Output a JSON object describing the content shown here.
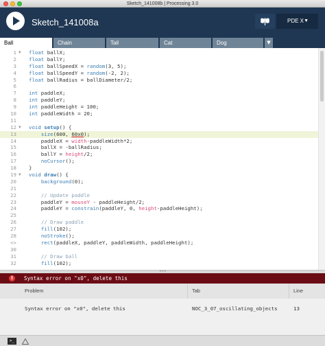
{
  "window": {
    "title": "Sketch_141008b  |  Processing 3.0"
  },
  "toolbar": {
    "sketch_name": "Sketch_141008a",
    "mode_label": "PDE X",
    "mode_caret": "▼"
  },
  "tabs": [
    {
      "label": "Ball",
      "active": true
    },
    {
      "label": "Chain",
      "active": false
    },
    {
      "label": "Tail",
      "active": false
    },
    {
      "label": "Cat",
      "active": false
    },
    {
      "label": "Dog",
      "active": false
    }
  ],
  "tab_menu_glyph": "▼",
  "editor": {
    "current_line": 13,
    "error_line": 12,
    "lines": [
      {
        "n": "1",
        "fold": "▼",
        "text": "float ballX;"
      },
      {
        "n": "2",
        "fold": "",
        "text": "float ballY;"
      },
      {
        "n": "3",
        "fold": "",
        "text": "float ballSpeedX = random(3, 5);"
      },
      {
        "n": "4",
        "fold": "",
        "text": "float ballSpeedY = random(-2, 2);"
      },
      {
        "n": "5",
        "fold": "",
        "text": "float ballRadius = ballDiameter/2;"
      },
      {
        "n": "6",
        "fold": "",
        "text": ""
      },
      {
        "n": "7",
        "fold": "",
        "text": "int paddleX;"
      },
      {
        "n": "8",
        "fold": "",
        "text": "int paddleY;"
      },
      {
        "n": "9",
        "fold": "",
        "text": "int paddleHeight = 100;"
      },
      {
        "n": "10",
        "fold": "",
        "text": "int paddleWidth = 20;"
      },
      {
        "n": "11",
        "fold": "",
        "text": ""
      },
      {
        "n": "12",
        "fold": "▼",
        "text": "void setup() {"
      },
      {
        "n": "13",
        "fold": "",
        "text": "    size(600, 60x0);"
      },
      {
        "n": "14",
        "fold": "",
        "text": "    paddleX = width-paddleWidth*2;"
      },
      {
        "n": "15",
        "fold": "",
        "text": "    ballX = -ballRadius;"
      },
      {
        "n": "16",
        "fold": "",
        "text": "    ballY = height/2;"
      },
      {
        "n": "17",
        "fold": "",
        "text": "    noCursor();"
      },
      {
        "n": "18",
        "fold": "",
        "text": "}"
      },
      {
        "n": "19",
        "fold": "▼",
        "text": "void draw() {"
      },
      {
        "n": "20",
        "fold": "",
        "text": "    background(0);"
      },
      {
        "n": "21",
        "fold": "",
        "text": ""
      },
      {
        "n": "22",
        "fold": "",
        "text": "    // Update paddle"
      },
      {
        "n": "23",
        "fold": "",
        "text": "    paddleY = mouseY - paddleHeight/2;"
      },
      {
        "n": "24",
        "fold": "",
        "text": "    paddleY = constrain(paddleY, 0, height-paddleHeight);"
      },
      {
        "n": "25",
        "fold": "",
        "text": ""
      },
      {
        "n": "26",
        "fold": "",
        "text": "    // Draw paddle"
      },
      {
        "n": "27",
        "fold": "",
        "text": "    fill(102);"
      },
      {
        "n": "28",
        "fold": "",
        "text": "    noStroke();"
      },
      {
        "n": "<>",
        "fold": "",
        "text": "    rect(paddleX, paddleY, paddleWidth, paddleHeight);"
      },
      {
        "n": "30",
        "fold": "",
        "text": ""
      },
      {
        "n": "31",
        "fold": "",
        "text": "    // Draw ball"
      },
      {
        "n": "32",
        "fold": "",
        "text": "    fill(102);"
      }
    ]
  },
  "divider_grip": "•••",
  "error_bar": {
    "icon": "!",
    "message": "Syntax error on \"x0\", delete this"
  },
  "problems": {
    "headers": {
      "problem": "Problem",
      "tab": "Tab",
      "line": "Line"
    },
    "rows": [
      {
        "problem": "Syntax error on \"x0\", delete this",
        "tab": "NOC_3_07_oscillating_objects",
        "line": "13"
      }
    ]
  },
  "footer": {
    "console_glyph": ">_"
  },
  "colors": {
    "toolbar_bg": "#1f3753",
    "tab_inactive": "#6f8497",
    "keyword": "#3a7eb4",
    "builtin_var": "#d94a7a",
    "comment": "#8aa0b4",
    "error_bar": "#6b0c14",
    "current_line_highlight": "#f0f4d8"
  }
}
